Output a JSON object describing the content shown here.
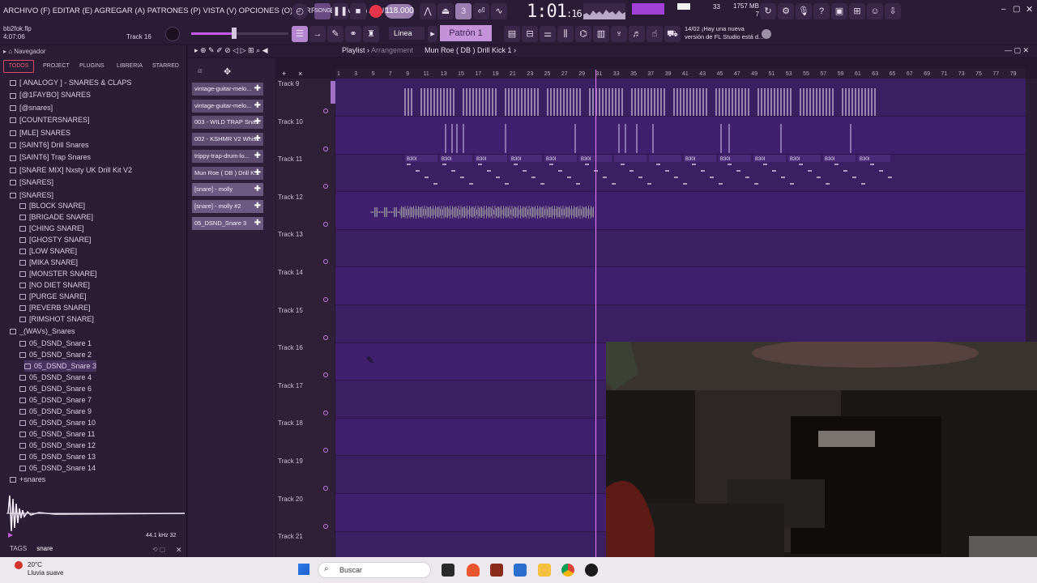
{
  "menubar": {
    "menu_text": "ARCHIVO (F) EDITAR (E) AGREGAR (A) PATRONES (P) VISTA (V) OPCIONES (O) HERRAMIENTAS (T) AYUDA",
    "tempo": "118.000",
    "time_main": "1:01",
    "time_sub": "16",
    "memory": "1757 MB",
    "cpu_num": "33",
    "mem_num": "7"
  },
  "toolbar2": {
    "project_file": "bb2fok.flp",
    "project_time": "4:07:06",
    "track_hint": "Track 16",
    "linea_label": "Línea",
    "pattern_label": "Patrón 1",
    "news_date": "14/02",
    "news_line1": "¡Hay una nueva",
    "news_line2": "versión de FL Studio está d..."
  },
  "browser": {
    "title": "Navegador",
    "tabs": [
      "TODOS",
      "PROJECT",
      "PLUGINS",
      "LIBRERIA",
      "STARRED"
    ],
    "tree": [
      "[ ANALOGY ] - SNARES & CLAPS",
      "[@1FAYBO] SNARES",
      "[@snares]",
      "[COUNTERSNARES]",
      "[MLE] SNARES",
      "[SAINT6] Drill Snares",
      "[SAINT6] Trap Snares",
      "[SNARE MIX] Nxsty UK Drill Kit V2",
      "[SNARES]",
      "[SNARES]"
    ],
    "subfolders": [
      "[BLOCK SNARE]",
      "[BRIGADE SNARE]",
      "[CHING SNARE]",
      "[GHOSTY SNARE]",
      "[LOW SNARE]",
      "[MIKA SNARE]",
      "[MONSTER SNARE]",
      "[NO DIET SNARE]",
      "[PURGE SNARE]",
      "[REVERB SNARE]",
      "[RIMSHOT SNARE]"
    ],
    "wavs_folder": "_(WAVs)_Snares",
    "files": [
      "05_DSND_Snare 1",
      "05_DSND_Snare 2",
      "05_DSND_Snare 3",
      "05_DSND_Snare 4",
      "05_DSND_Snare 6",
      "05_DSND_Snare 7",
      "05_DSND_Snare 9",
      "05_DSND_Snare 10",
      "05_DSND_Snare 11",
      "05_DSND_Snare 12",
      "05_DSND_Snare 13",
      "05_DSND_Snare 14"
    ],
    "extra_folder": "+snares",
    "wave_info": "44.1 kHz 32",
    "tags_label": "TAGS",
    "tags_value": "snare"
  },
  "channels": [
    "vintage-guitar-melo...",
    "vintage-guitar-melo...",
    "003 - WILD TRAP Sna...",
    "002 - KSHMR V2 Whis...",
    "trippy-trap-drum-lo...",
    "Mun Roe ( DB ) Drill K...",
    "[snare] - molly",
    "[snare] - molly #2",
    "05_DSND_Snare 3"
  ],
  "playlist": {
    "title": "Playlist",
    "subtitle": "Arrangement",
    "pattern": "Mun Roe ( DB ) Drill Kick 1",
    "tracks": [
      "Track 9",
      "Track 10",
      "Track 11",
      "Track 12",
      "Track 13",
      "Track 14",
      "Track 15",
      "Track 16",
      "Track 17",
      "Track 18",
      "Track 19",
      "Track 20",
      "Track 21"
    ],
    "ruler": [
      "1",
      "3",
      "5",
      "7",
      "9",
      "11",
      "13",
      "15",
      "17",
      "19",
      "21",
      "23",
      "25",
      "27",
      "29",
      "31",
      "33",
      "35",
      "37",
      "39",
      "41",
      "43",
      "45",
      "47",
      "49",
      "51",
      "53",
      "55",
      "57",
      "59",
      "61",
      "63",
      "65",
      "67",
      "69",
      "71",
      "73",
      "75",
      "77",
      "79"
    ],
    "clip_label": "B30I"
  },
  "taskbar": {
    "temp": "20°C",
    "weather": "Lluvia suave",
    "search_placeholder": "Buscar"
  }
}
